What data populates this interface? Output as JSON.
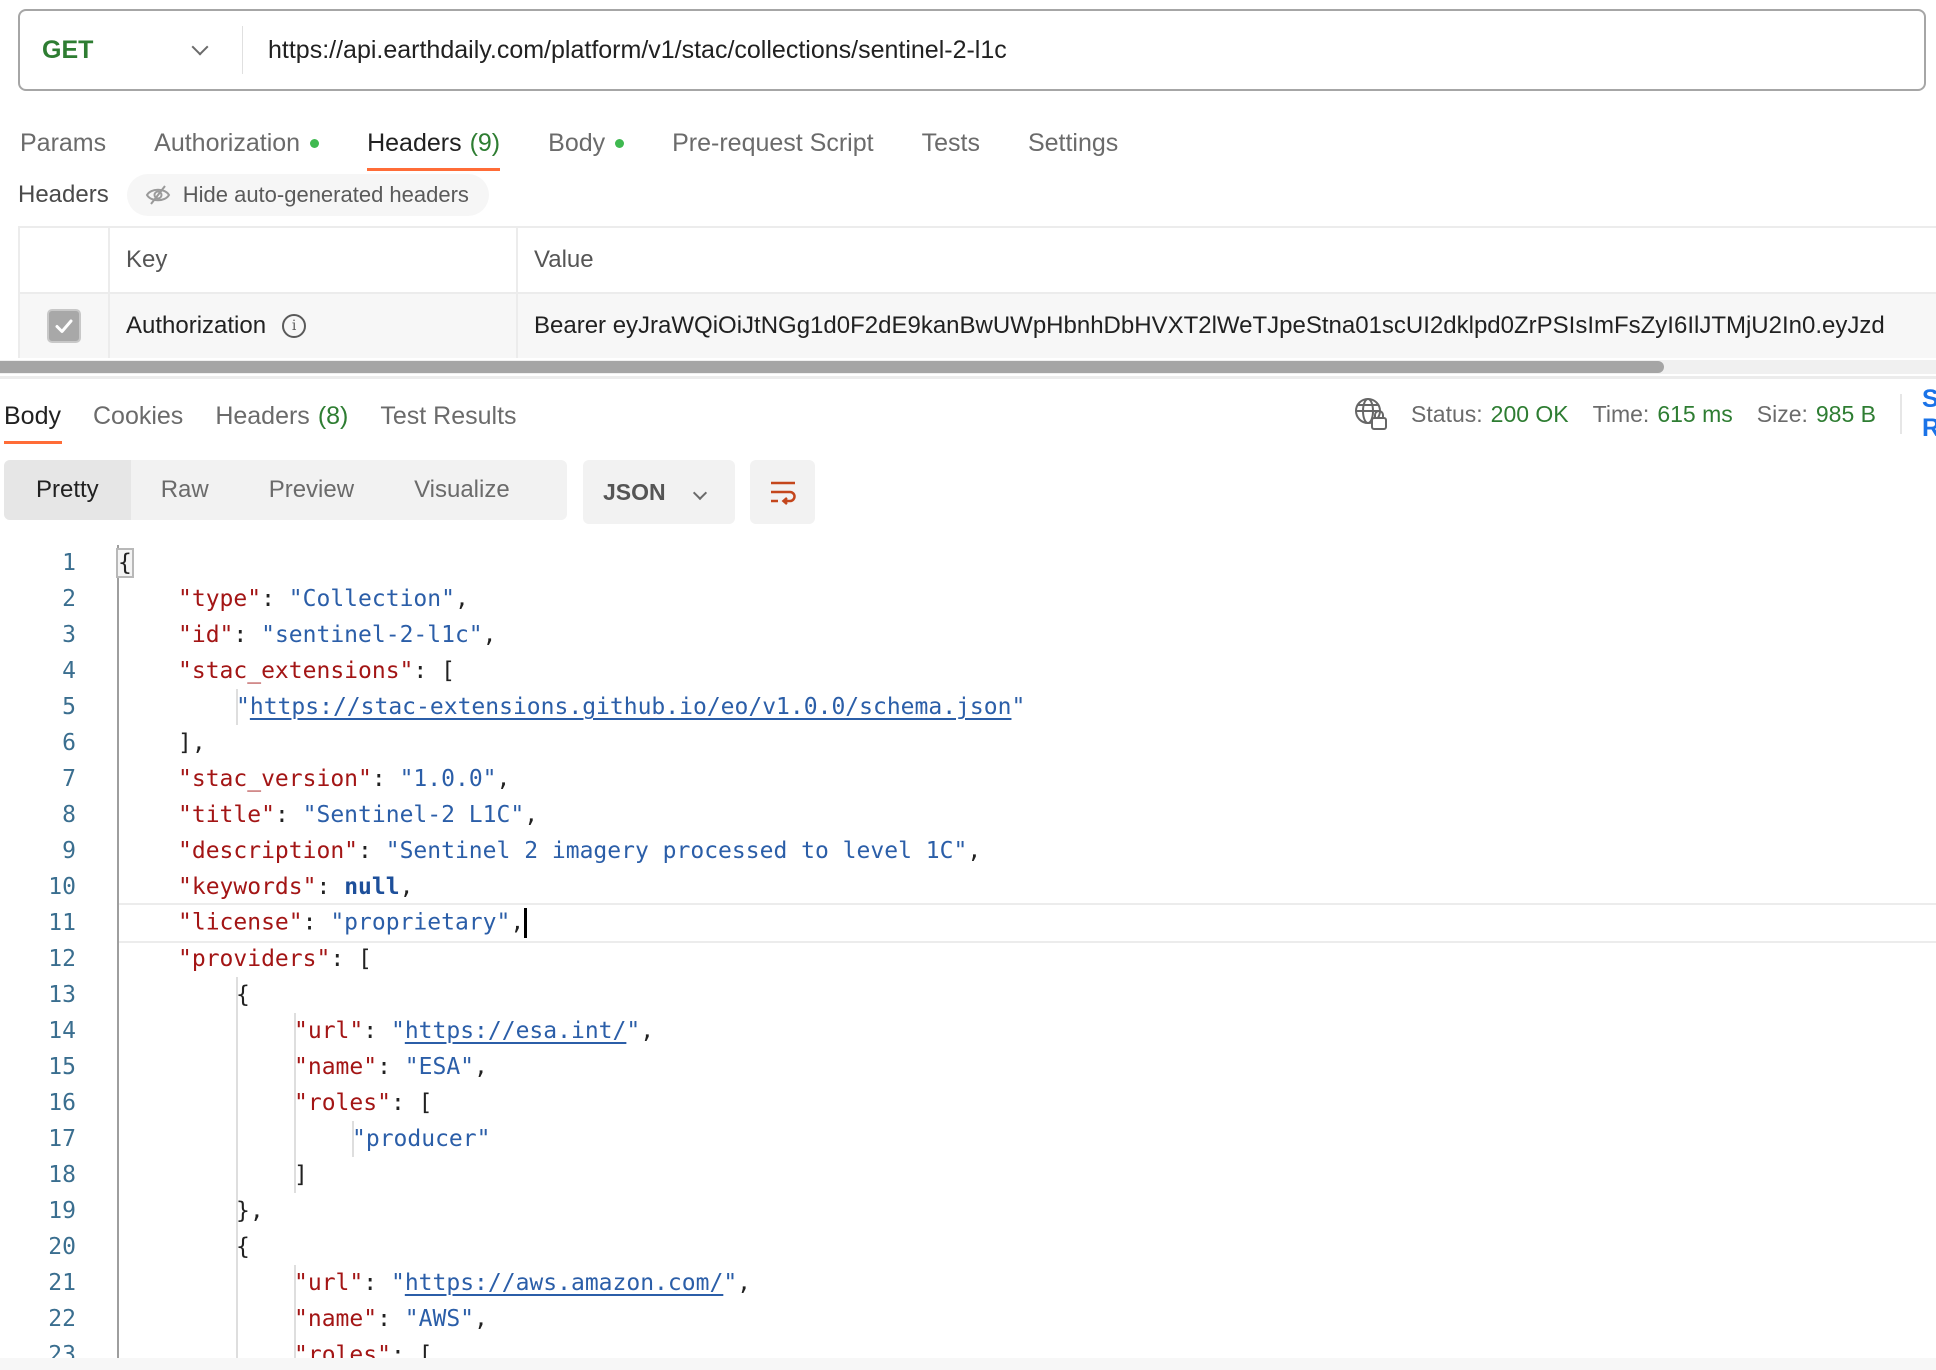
{
  "request": {
    "method": "GET",
    "url": "https://api.earthdaily.com/platform/v1/stac/collections/sentinel-2-l1c"
  },
  "request_tabs": [
    {
      "label": "Params"
    },
    {
      "label": "Authorization",
      "dot": true
    },
    {
      "label": "Headers",
      "count": "(9)",
      "active": true
    },
    {
      "label": "Body",
      "dot": true
    },
    {
      "label": "Pre-request Script"
    },
    {
      "label": "Tests"
    },
    {
      "label": "Settings"
    }
  ],
  "headers_section": {
    "label": "Headers",
    "hide_button": "Hide auto-generated headers",
    "columns": {
      "key": "Key",
      "value": "Value"
    },
    "rows": [
      {
        "checked": true,
        "key": "Authorization",
        "value": "Bearer eyJraWQiOiJtNGg1d0F2dE9kanBwUWpHbnhDbHVXT2lWeTJpeStna01scUI2dklpd0ZrPSIsImFsZyI6IlJTMjU2In0.eyJzd"
      }
    ]
  },
  "response_tabs": [
    {
      "label": "Body",
      "active": true
    },
    {
      "label": "Cookies"
    },
    {
      "label": "Headers",
      "count": "(8)"
    },
    {
      "label": "Test Results"
    }
  ],
  "response_status": {
    "status_label": "Status:",
    "status": "200 OK",
    "time_label": "Time:",
    "time": "615 ms",
    "size_label": "Size:",
    "size": "985 B",
    "save_label": "Save Response"
  },
  "format_tabs": [
    "Pretty",
    "Raw",
    "Preview",
    "Visualize"
  ],
  "format_active": "Pretty",
  "language": "JSON",
  "code_lines": [
    [
      {
        "t": "p",
        "v": "{"
      }
    ],
    [
      {
        "t": "k",
        "v": "\"type\""
      },
      {
        "t": "p",
        "v": ": "
      },
      {
        "t": "s",
        "v": "\"Collection\""
      },
      {
        "t": "p",
        "v": ","
      }
    ],
    [
      {
        "t": "k",
        "v": "\"id\""
      },
      {
        "t": "p",
        "v": ": "
      },
      {
        "t": "s",
        "v": "\"sentinel-2-l1c\""
      },
      {
        "t": "p",
        "v": ","
      }
    ],
    [
      {
        "t": "k",
        "v": "\"stac_extensions\""
      },
      {
        "t": "p",
        "v": ": ["
      }
    ],
    [
      {
        "t": "s",
        "v": "\""
      },
      {
        "t": "lnk",
        "v": "https://stac-extensions.github.io/eo/v1.0.0/schema.json"
      },
      {
        "t": "s",
        "v": "\""
      }
    ],
    [
      {
        "t": "p",
        "v": "],"
      }
    ],
    [
      {
        "t": "k",
        "v": "\"stac_version\""
      },
      {
        "t": "p",
        "v": ": "
      },
      {
        "t": "s",
        "v": "\"1.0.0\""
      },
      {
        "t": "p",
        "v": ","
      }
    ],
    [
      {
        "t": "k",
        "v": "\"title\""
      },
      {
        "t": "p",
        "v": ": "
      },
      {
        "t": "s",
        "v": "\"Sentinel-2 L1C\""
      },
      {
        "t": "p",
        "v": ","
      }
    ],
    [
      {
        "t": "k",
        "v": "\"description\""
      },
      {
        "t": "p",
        "v": ": "
      },
      {
        "t": "s",
        "v": "\"Sentinel 2 imagery processed to level 1C\""
      },
      {
        "t": "p",
        "v": ","
      }
    ],
    [
      {
        "t": "k",
        "v": "\"keywords\""
      },
      {
        "t": "p",
        "v": ": "
      },
      {
        "t": "n",
        "v": "null"
      },
      {
        "t": "p",
        "v": ","
      }
    ],
    [
      {
        "t": "k",
        "v": "\"license\""
      },
      {
        "t": "p",
        "v": ": "
      },
      {
        "t": "s",
        "v": "\"proprietary\""
      },
      {
        "t": "p",
        "v": ","
      }
    ],
    [
      {
        "t": "k",
        "v": "\"providers\""
      },
      {
        "t": "p",
        "v": ": ["
      }
    ],
    [
      {
        "t": "p",
        "v": "{"
      }
    ],
    [
      {
        "t": "k",
        "v": "\"url\""
      },
      {
        "t": "p",
        "v": ": "
      },
      {
        "t": "s",
        "v": "\""
      },
      {
        "t": "lnk",
        "v": "https://esa.int/"
      },
      {
        "t": "s",
        "v": "\""
      },
      {
        "t": "p",
        "v": ","
      }
    ],
    [
      {
        "t": "k",
        "v": "\"name\""
      },
      {
        "t": "p",
        "v": ": "
      },
      {
        "t": "s",
        "v": "\"ESA\""
      },
      {
        "t": "p",
        "v": ","
      }
    ],
    [
      {
        "t": "k",
        "v": "\"roles\""
      },
      {
        "t": "p",
        "v": ": ["
      }
    ],
    [
      {
        "t": "s",
        "v": "\"producer\""
      }
    ],
    [
      {
        "t": "p",
        "v": "]"
      }
    ],
    [
      {
        "t": "p",
        "v": "},"
      }
    ],
    [
      {
        "t": "p",
        "v": "{"
      }
    ],
    [
      {
        "t": "k",
        "v": "\"url\""
      },
      {
        "t": "p",
        "v": ": "
      },
      {
        "t": "s",
        "v": "\""
      },
      {
        "t": "lnk",
        "v": "https://aws.amazon.com/"
      },
      {
        "t": "s",
        "v": "\""
      },
      {
        "t": "p",
        "v": ","
      }
    ],
    [
      {
        "t": "k",
        "v": "\"name\""
      },
      {
        "t": "p",
        "v": ": "
      },
      {
        "t": "s",
        "v": "\"AWS\""
      },
      {
        "t": "p",
        "v": ","
      }
    ],
    [
      {
        "t": "k",
        "v": "\"roles\""
      },
      {
        "t": "p",
        "v": ": ["
      }
    ]
  ],
  "code_indent": [
    0,
    1,
    1,
    1,
    2,
    1,
    1,
    1,
    1,
    1,
    1,
    1,
    2,
    3,
    3,
    3,
    4,
    3,
    2,
    2,
    3,
    3,
    3
  ],
  "current_line": 11
}
